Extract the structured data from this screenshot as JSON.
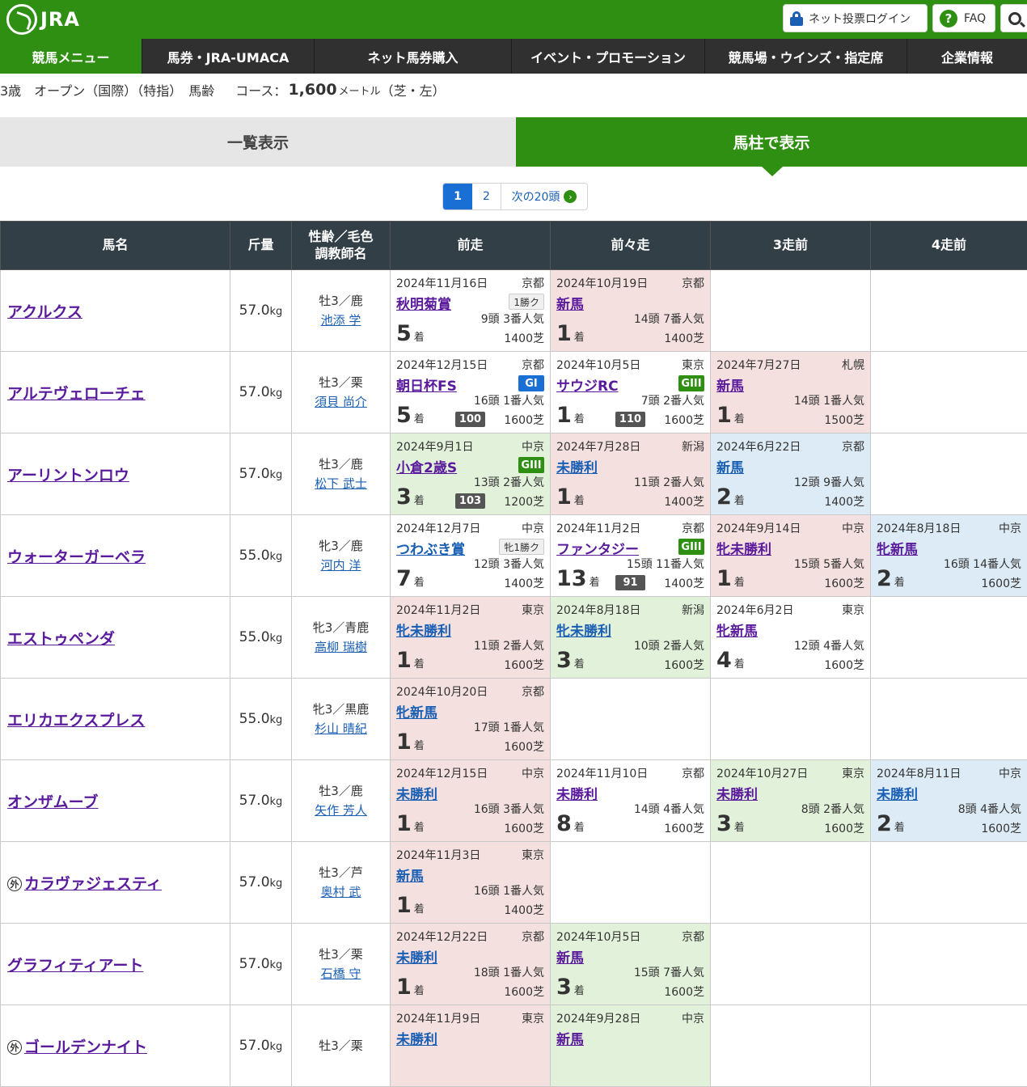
{
  "header": {
    "logo_text": "JRA",
    "login_label": "ネット投票ログイン",
    "faq_label": "FAQ"
  },
  "nav": [
    "競馬メニュー",
    "馬券・JRA-UMACA",
    "ネット馬券購入",
    "イベント・プロモーション",
    "競馬場・ウインズ・指定席",
    "企業情報"
  ],
  "race_info": {
    "cond": "3歳　オープン（国際）（特指）　馬齢",
    "course_label": "コース：",
    "distance": "1,600",
    "unit": "メートル",
    "surface": "（芝・左）"
  },
  "view_toggle": {
    "list": "一覧表示",
    "column": "馬柱で表示"
  },
  "pager": {
    "p1": "1",
    "p2": "2",
    "next": "次の20頭"
  },
  "columns": {
    "name": "馬名",
    "weight": "斤量",
    "sex": "性齢／毛色",
    "trainer": "調教師名",
    "r1": "前走",
    "r2": "前々走",
    "r3": "3走前",
    "r4": "4走前"
  },
  "horses": [
    {
      "name": "アクルクス",
      "weight": "57.0",
      "sex": "牡3／鹿",
      "trainer": "池添 学",
      "runs": [
        {
          "bg": "white",
          "date": "2024年11月16日",
          "venue": "京都",
          "race": "秋明菊賞",
          "badge_type": "cls",
          "badge": "1勝ク",
          "place": "5",
          "field": "9頭 3番人気",
          "dist": "1400芝"
        },
        {
          "bg": "pink",
          "date": "2024年10月19日",
          "venue": "京都",
          "race": "新馬",
          "place": "1",
          "field": "14頭 7番人気",
          "dist": "1400芝"
        },
        null,
        null
      ]
    },
    {
      "name": "アルテヴェローチェ",
      "weight": "57.0",
      "sex": "牡3／栗",
      "trainer": "須貝 尚介",
      "runs": [
        {
          "bg": "white",
          "date": "2024年12月15日",
          "venue": "京都",
          "race": "朝日杯FS",
          "badge_type": "g1",
          "badge": "GI",
          "place": "5",
          "field": "16頭 1番人気",
          "dist": "1600芝",
          "score": "100"
        },
        {
          "bg": "white",
          "date": "2024年10月5日",
          "venue": "東京",
          "race": "サウジRC",
          "badge_type": "g3",
          "badge": "GIII",
          "place": "1",
          "field": "7頭 2番人気",
          "dist": "1600芝",
          "score": "110"
        },
        {
          "bg": "pink",
          "date": "2024年7月27日",
          "venue": "札幌",
          "race": "新馬",
          "place": "1",
          "field": "14頭 1番人気",
          "dist": "1500芝"
        },
        null
      ]
    },
    {
      "name": "アーリントンロウ",
      "weight": "57.0",
      "sex": "牡3／鹿",
      "trainer": "松下 武士",
      "runs": [
        {
          "bg": "green",
          "date": "2024年9月1日",
          "venue": "中京",
          "race": "小倉2歳S",
          "badge_type": "g3",
          "badge": "GIII",
          "place": "3",
          "field": "13頭 2番人気",
          "dist": "1200芝",
          "score": "103"
        },
        {
          "bg": "pink",
          "date": "2024年7月28日",
          "venue": "新潟",
          "race": "未勝利",
          "rblue": true,
          "place": "1",
          "field": "11頭 2番人気",
          "dist": "1400芝"
        },
        {
          "bg": "blue",
          "date": "2024年6月22日",
          "venue": "京都",
          "race": "新馬",
          "rblue": true,
          "place": "2",
          "field": "12頭 9番人気",
          "dist": "1400芝"
        },
        null
      ]
    },
    {
      "name": "ウォーターガーベラ",
      "weight": "55.0",
      "sex": "牝3／鹿",
      "trainer": "河内 洋",
      "runs": [
        {
          "bg": "white",
          "date": "2024年12月7日",
          "venue": "中京",
          "race": "つわぶき賞",
          "rblue": true,
          "badge_type": "cls",
          "badge": "牝1勝ク",
          "place": "7",
          "field": "12頭 3番人気",
          "dist": "1400芝"
        },
        {
          "bg": "white",
          "date": "2024年11月2日",
          "venue": "京都",
          "race": "ファンタジー",
          "badge_type": "g3",
          "badge": "GIII",
          "place": "13",
          "field": "15頭 11番人気",
          "dist": "1400芝",
          "score": "91"
        },
        {
          "bg": "pink",
          "date": "2024年9月14日",
          "venue": "中京",
          "race": "牝未勝利",
          "place": "1",
          "field": "15頭 5番人気",
          "dist": "1600芝"
        },
        {
          "bg": "blue",
          "date": "2024年8月18日",
          "venue": "中京",
          "race": "牝新馬",
          "place": "2",
          "field": "16頭 14番人気",
          "dist": "1600芝"
        }
      ]
    },
    {
      "name": "エストゥペンダ",
      "weight": "55.0",
      "sex": "牝3／青鹿",
      "trainer": "高柳 瑞樹",
      "runs": [
        {
          "bg": "pink",
          "date": "2024年11月2日",
          "venue": "東京",
          "race": "牝未勝利",
          "rblue": true,
          "place": "1",
          "field": "11頭 2番人気",
          "dist": "1600芝"
        },
        {
          "bg": "green",
          "date": "2024年8月18日",
          "venue": "新潟",
          "race": "牝未勝利",
          "rblue": true,
          "place": "3",
          "field": "10頭 2番人気",
          "dist": "1600芝"
        },
        {
          "bg": "white",
          "date": "2024年6月2日",
          "venue": "東京",
          "race": "牝新馬",
          "place": "4",
          "field": "12頭 4番人気",
          "dist": "1600芝"
        },
        null
      ]
    },
    {
      "name": "エリカエクスプレス",
      "weight": "55.0",
      "sex": "牝3／黒鹿",
      "trainer": "杉山 晴紀",
      "runs": [
        {
          "bg": "pink",
          "date": "2024年10月20日",
          "venue": "京都",
          "race": "牝新馬",
          "rblue": true,
          "place": "1",
          "field": "17頭 1番人気",
          "dist": "1600芝"
        },
        null,
        null,
        null
      ]
    },
    {
      "name": "オンザムーブ",
      "weight": "57.0",
      "sex": "牡3／鹿",
      "trainer": "矢作 芳人",
      "runs": [
        {
          "bg": "pink",
          "date": "2024年12月15日",
          "venue": "中京",
          "race": "未勝利",
          "rblue": true,
          "place": "1",
          "field": "16頭 3番人気",
          "dist": "1600芝"
        },
        {
          "bg": "white",
          "date": "2024年11月10日",
          "venue": "京都",
          "race": "未勝利",
          "place": "8",
          "field": "14頭 4番人気",
          "dist": "1600芝"
        },
        {
          "bg": "green",
          "date": "2024年10月27日",
          "venue": "東京",
          "race": "未勝利",
          "place": "3",
          "field": "8頭 2番人気",
          "dist": "1600芝"
        },
        {
          "bg": "blue",
          "date": "2024年8月11日",
          "venue": "中京",
          "race": "未勝利",
          "rblue": true,
          "place": "2",
          "field": "8頭 4番人気",
          "dist": "1600芝"
        }
      ]
    },
    {
      "name": "カラヴァジェスティ",
      "gai": "外",
      "weight": "57.0",
      "sex": "牡3／芦",
      "trainer": "奥村 武",
      "runs": [
        {
          "bg": "pink",
          "date": "2024年11月3日",
          "venue": "東京",
          "race": "新馬",
          "rblue": true,
          "place": "1",
          "field": "16頭 1番人気",
          "dist": "1400芝"
        },
        null,
        null,
        null
      ]
    },
    {
      "name": "グラフィティアート",
      "weight": "57.0",
      "sex": "牡3／栗",
      "trainer": "石橋 守",
      "runs": [
        {
          "bg": "pink",
          "date": "2024年12月22日",
          "venue": "京都",
          "race": "未勝利",
          "rblue": true,
          "place": "1",
          "field": "18頭 1番人気",
          "dist": "1600芝"
        },
        {
          "bg": "green",
          "date": "2024年10月5日",
          "venue": "京都",
          "race": "新馬",
          "place": "3",
          "field": "15頭 7番人気",
          "dist": "1600芝"
        },
        null,
        null
      ]
    },
    {
      "name": "ゴールデンナイト",
      "gai": "外",
      "weight": "57.0",
      "sex": "牡3／栗",
      "trainer": "",
      "runs": [
        {
          "bg": "pink",
          "date": "2024年11月9日",
          "venue": "東京",
          "race": "未勝利",
          "rblue": true,
          "place": "",
          "field": "",
          "dist": ""
        },
        {
          "bg": "green",
          "date": "2024年9月28日",
          "venue": "中京",
          "race": "新馬",
          "place": "",
          "field": "",
          "dist": ""
        },
        null,
        null
      ]
    }
  ],
  "place_suffix": "着"
}
